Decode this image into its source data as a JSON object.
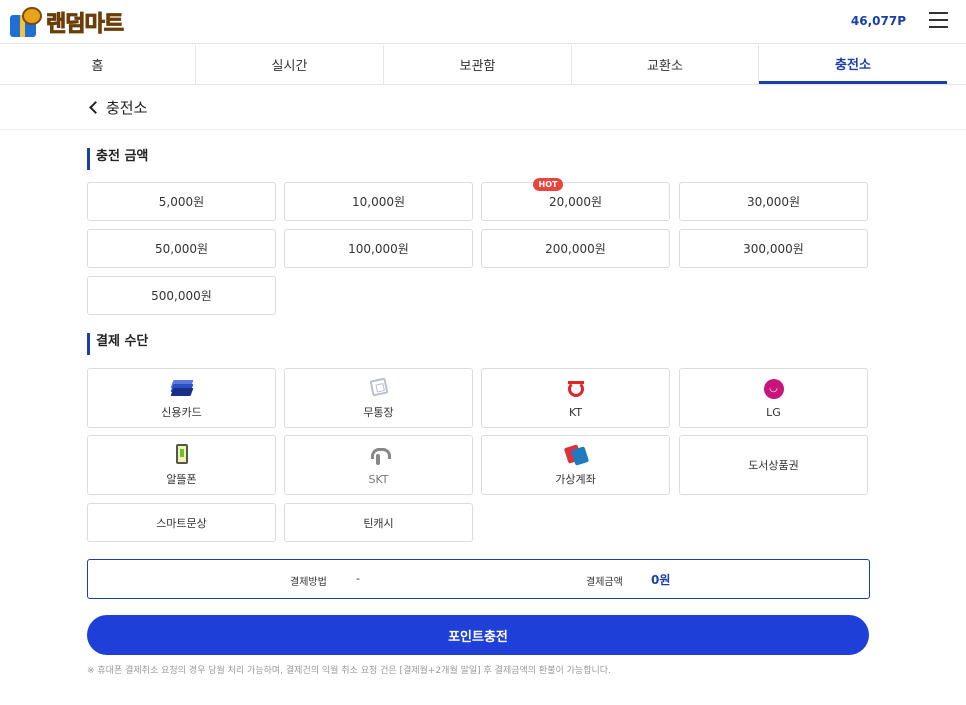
{
  "header": {
    "logo_text": "랜덤마트",
    "points": "46,077P"
  },
  "tabs": [
    {
      "label": "홈",
      "active": false
    },
    {
      "label": "실시간",
      "active": false
    },
    {
      "label": "보관함",
      "active": false
    },
    {
      "label": "교환소",
      "active": false
    },
    {
      "label": "충전소",
      "active": true
    }
  ],
  "page": {
    "title": "충전소"
  },
  "amount_section": {
    "title": "충전 금액",
    "hot_badge": "HOT",
    "options": [
      "5,000원",
      "10,000원",
      "20,000원",
      "30,000원",
      "50,000원",
      "100,000원",
      "200,000원",
      "300,000원",
      "500,000원"
    ]
  },
  "payment_section": {
    "title": "결제 수단",
    "methods": [
      {
        "label": "신용카드",
        "icon": "credit-card-icon"
      },
      {
        "label": "무통장",
        "icon": "bank-transfer-icon"
      },
      {
        "label": "KT",
        "icon": "kt-logo-icon"
      },
      {
        "label": "LG",
        "icon": "lg-logo-icon"
      },
      {
        "label": "알뜰폰",
        "icon": "mobile-phone-icon"
      },
      {
        "label": "SKT",
        "icon": "skt-logo-icon"
      },
      {
        "label": "가상계좌",
        "icon": "virtual-account-icon"
      },
      {
        "label": "도서상품권",
        "icon": ""
      },
      {
        "label": "스마트문상",
        "icon": ""
      },
      {
        "label": "틴캐시",
        "icon": ""
      }
    ]
  },
  "summary": {
    "method_label": "결제방법",
    "method_value": "-",
    "amount_label": "결제금액",
    "amount_value": "0원"
  },
  "charge_button": "포인트충전",
  "notice": "※ 휴대폰 결제취소 요청의 경우 당월 처리 가능하며, 결제건의 익월 취소 요청 건은 [결제월+2개월 말일] 후 결제금액의 환불이 가능합니다.",
  "colors": {
    "accent": "#1a3fa8",
    "button": "#1e3fd8",
    "hot": "#e8453c"
  }
}
